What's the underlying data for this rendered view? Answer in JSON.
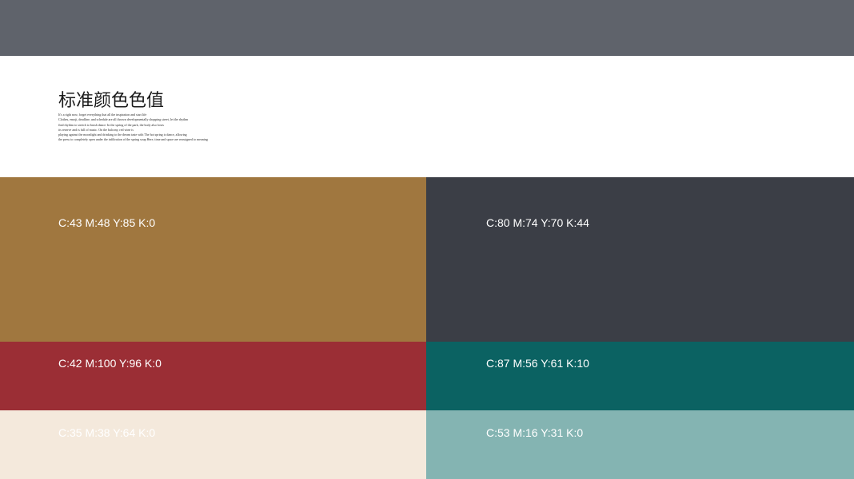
{
  "title": "标准颜色色值",
  "description_lines": [
    "It's a right now, forget everything that all the inspiration and start life",
    "Clothes, emoji, deadline, and schedule are all thrown developmentally shopping street, let the rhythm",
    "find rhythm to stretch to brush dance. In the spring of the park, the body also loses",
    "its reserve and is full of music. On the balcony, red wine is",
    "playing against the moonlight and drinking to the dream taste with The hot spring is dance, allowing",
    "the press to completely open under the infiltration of the spring soup Here, time and space are reassigned to meaning"
  ],
  "swatches": [
    {
      "label": "C:43 M:48 Y:85 K:0",
      "color": "#a0773f"
    },
    {
      "label": "C:80 M:74 Y:70 K:44",
      "color": "#3b3e46"
    },
    {
      "label": "C:42 M:100 Y:96 K:0",
      "color": "#9b2e35"
    },
    {
      "label": "C:87 M:56 Y:61 K:10",
      "color": "#0b6262"
    },
    {
      "label": "C:35 M:38 Y:64 K:0",
      "color": "#f4e9dc"
    },
    {
      "label": "C:53 M:16 Y:31 K:0",
      "color": "#84b4b2"
    }
  ],
  "top_bar_color": "#5f636b"
}
